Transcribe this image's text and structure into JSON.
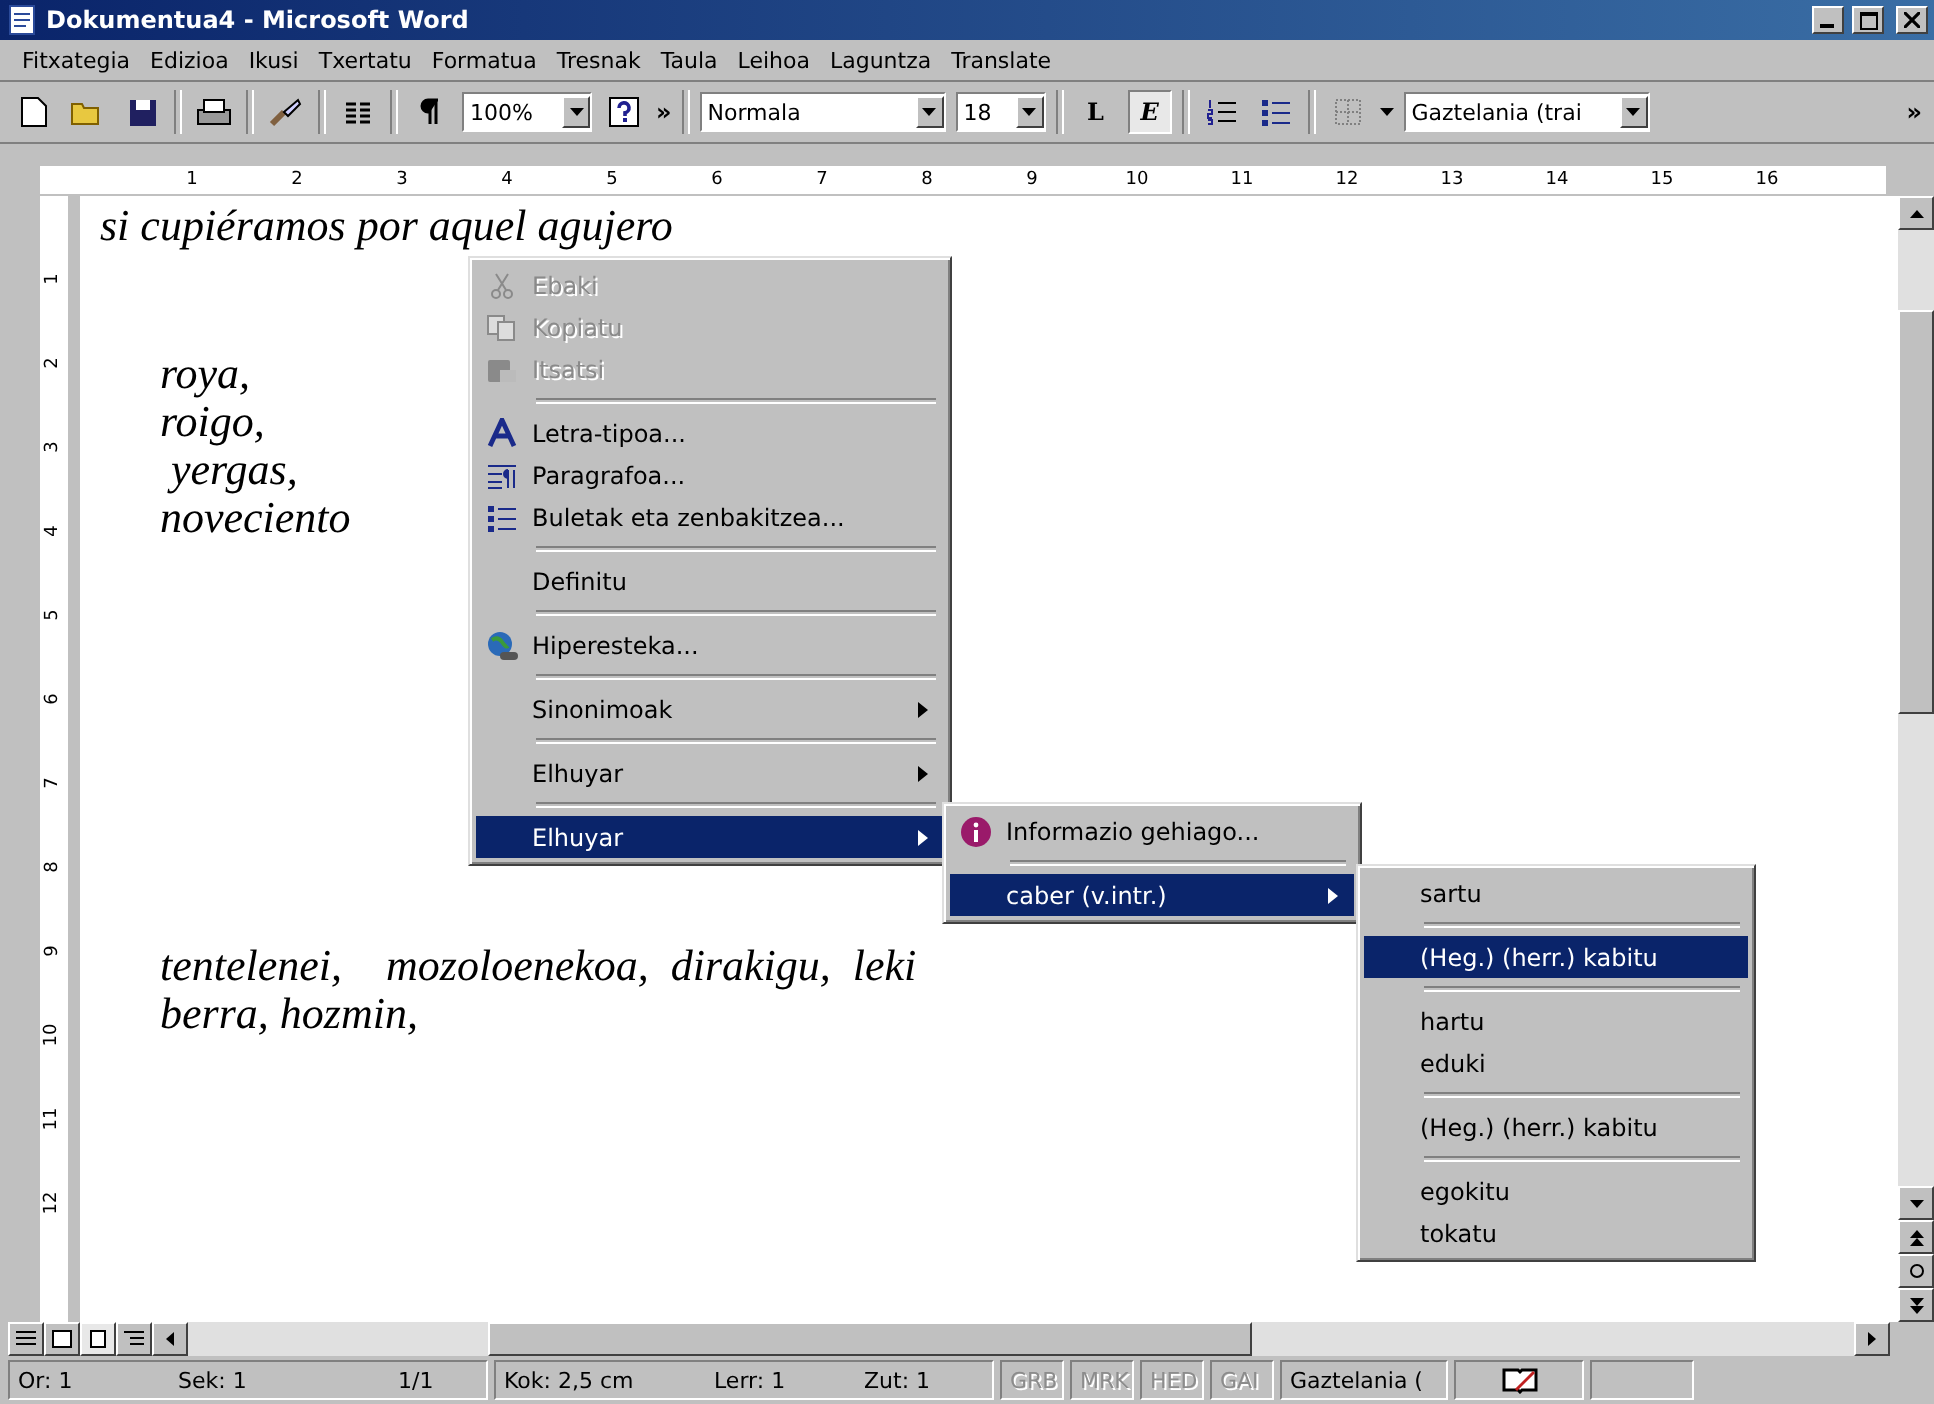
{
  "window": {
    "title": "Dokumentua4 - Microsoft Word"
  },
  "menubar": [
    "Fitxategia",
    "Edizioa",
    "Ikusi",
    "Txertatu",
    "Formatua",
    "Tresnak",
    "Taula",
    "Leihoa",
    "Laguntza",
    "Translate"
  ],
  "toolbar": {
    "zoom": "100%",
    "chevron_1": "»",
    "style": "Normala",
    "size": "18",
    "bold": "L",
    "italic": "E",
    "language": "Gaztelania (trai",
    "chevron_2": "»"
  },
  "ruler": {
    "h_numbers": [
      "1",
      "2",
      "3",
      "4",
      "5",
      "6",
      "7",
      "8",
      "9",
      "10",
      "11",
      "12",
      "13",
      "14",
      "15",
      "16"
    ],
    "v_numbers": [
      "1",
      "2",
      "3",
      "4",
      "5",
      "6",
      "7",
      "8",
      "9",
      "10",
      "11",
      "12"
    ]
  },
  "document": {
    "lines": [
      "si cupiéramos por aquel agujero",
      "roya,",
      "roigo,",
      " yergas,",
      "noveciento",
      "tentelenei,    mozoloenekoa,  dirakigu,  leki",
      "berra, hozmin,"
    ]
  },
  "context_menu": [
    {
      "kind": "item",
      "label": "Ebaki",
      "disabled": true,
      "selected": false,
      "submenu": false
    },
    {
      "kind": "item",
      "label": "Kopiatu",
      "disabled": true,
      "selected": false,
      "submenu": false
    },
    {
      "kind": "item",
      "label": "Itsatsi",
      "disabled": true,
      "selected": false,
      "submenu": false
    },
    {
      "kind": "separator"
    },
    {
      "kind": "item",
      "label": "Letra-tipoa...",
      "disabled": false,
      "selected": false,
      "submenu": false
    },
    {
      "kind": "item",
      "label": "Paragrafoa...",
      "disabled": false,
      "selected": false,
      "submenu": false
    },
    {
      "kind": "item",
      "label": "Buletak eta zenbakitzea...",
      "disabled": false,
      "selected": false,
      "submenu": false
    },
    {
      "kind": "separator"
    },
    {
      "kind": "item",
      "label": "Definitu",
      "disabled": false,
      "selected": false,
      "submenu": false
    },
    {
      "kind": "separator"
    },
    {
      "kind": "item",
      "label": "Hiperesteka...",
      "disabled": false,
      "selected": false,
      "submenu": false
    },
    {
      "kind": "separator"
    },
    {
      "kind": "item",
      "label": "Sinonimoak",
      "disabled": false,
      "selected": false,
      "submenu": true
    },
    {
      "kind": "separator"
    },
    {
      "kind": "item",
      "label": "Elhuyar",
      "disabled": false,
      "selected": false,
      "submenu": true
    },
    {
      "kind": "separator"
    },
    {
      "kind": "item",
      "label": "Elhuyar",
      "disabled": false,
      "selected": true,
      "submenu": true
    }
  ],
  "submenu_1": [
    {
      "kind": "item",
      "label": "Informazio gehiago...",
      "disabled": false,
      "selected": false,
      "submenu": false
    },
    {
      "kind": "separator"
    },
    {
      "kind": "item",
      "label": "caber (v.intr.)",
      "disabled": false,
      "selected": true,
      "submenu": true
    }
  ],
  "submenu_2": [
    {
      "kind": "item",
      "label": "sartu",
      "disabled": false,
      "selected": false,
      "submenu": false
    },
    {
      "kind": "separator"
    },
    {
      "kind": "item",
      "label": "(Heg.) (herr.) kabitu",
      "disabled": false,
      "selected": true,
      "submenu": false
    },
    {
      "kind": "separator"
    },
    {
      "kind": "item",
      "label": "hartu",
      "disabled": false,
      "selected": false,
      "submenu": false
    },
    {
      "kind": "item",
      "label": "eduki",
      "disabled": false,
      "selected": false,
      "submenu": false
    },
    {
      "kind": "separator"
    },
    {
      "kind": "item",
      "label": "(Heg.) (herr.) kabitu",
      "disabled": false,
      "selected": false,
      "submenu": false
    },
    {
      "kind": "separator"
    },
    {
      "kind": "item",
      "label": "egokitu",
      "disabled": false,
      "selected": false,
      "submenu": false
    },
    {
      "kind": "item",
      "label": "tokatu",
      "disabled": false,
      "selected": false,
      "submenu": false
    }
  ],
  "status_bar": {
    "fields": [
      "Or: 1",
      "Sek: 1",
      "1/1",
      "Kok: 2,5 cm",
      "Lerr: 1",
      "Zut: 1"
    ],
    "indicators": [
      {
        "text": "GRB",
        "disabled": true
      },
      {
        "text": "MRK",
        "disabled": true
      },
      {
        "text": "HED",
        "disabled": true
      },
      {
        "text": "GAI",
        "disabled": true
      }
    ],
    "language": "Gaztelania ("
  }
}
